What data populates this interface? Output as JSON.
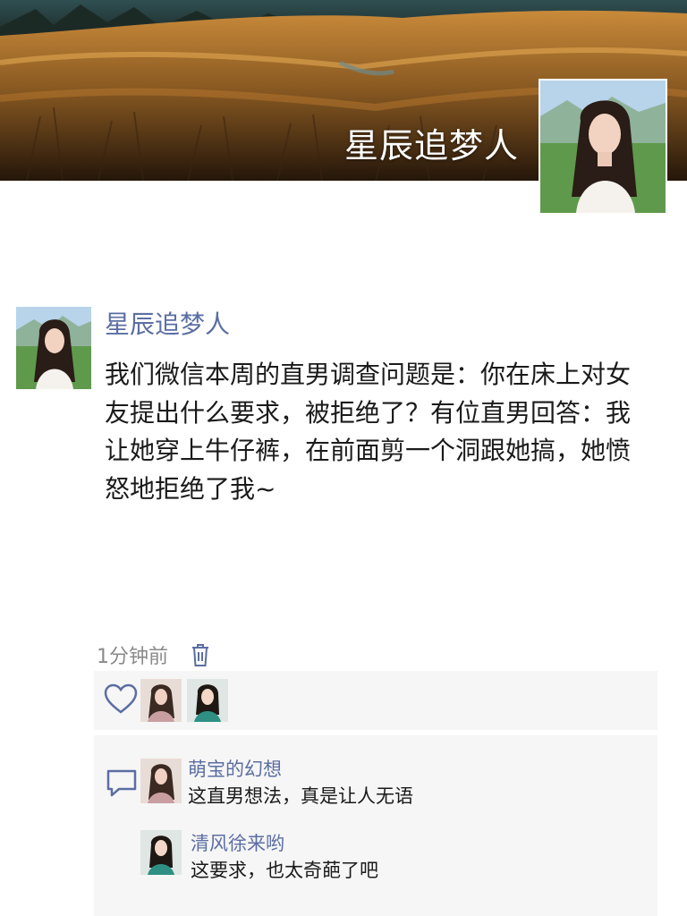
{
  "profile": {
    "name": "星辰追梦人"
  },
  "post": {
    "author": "星辰追梦人",
    "text": "我们微信本周的直男调查问题是：你在床上对女友提出什么要求，被拒绝了？有位直男回答：我让她穿上牛仔裤，在前面剪一个洞跟她搞，她愤怒地拒绝了我~",
    "time": "1分钟前"
  },
  "likes": {
    "count": 2
  },
  "comments": [
    {
      "author": "萌宝的幻想",
      "text": "这直男想法，真是让人无语"
    },
    {
      "author": "清风徐来哟",
      "text": "这要求，也太奇葩了吧"
    }
  ],
  "colors": {
    "name_link": "#5b6ea3",
    "panel_bg": "#f6f6f6",
    "icon": "#5b6ea3"
  },
  "icons": [
    "heart-icon",
    "comment-icon",
    "trash-icon"
  ]
}
